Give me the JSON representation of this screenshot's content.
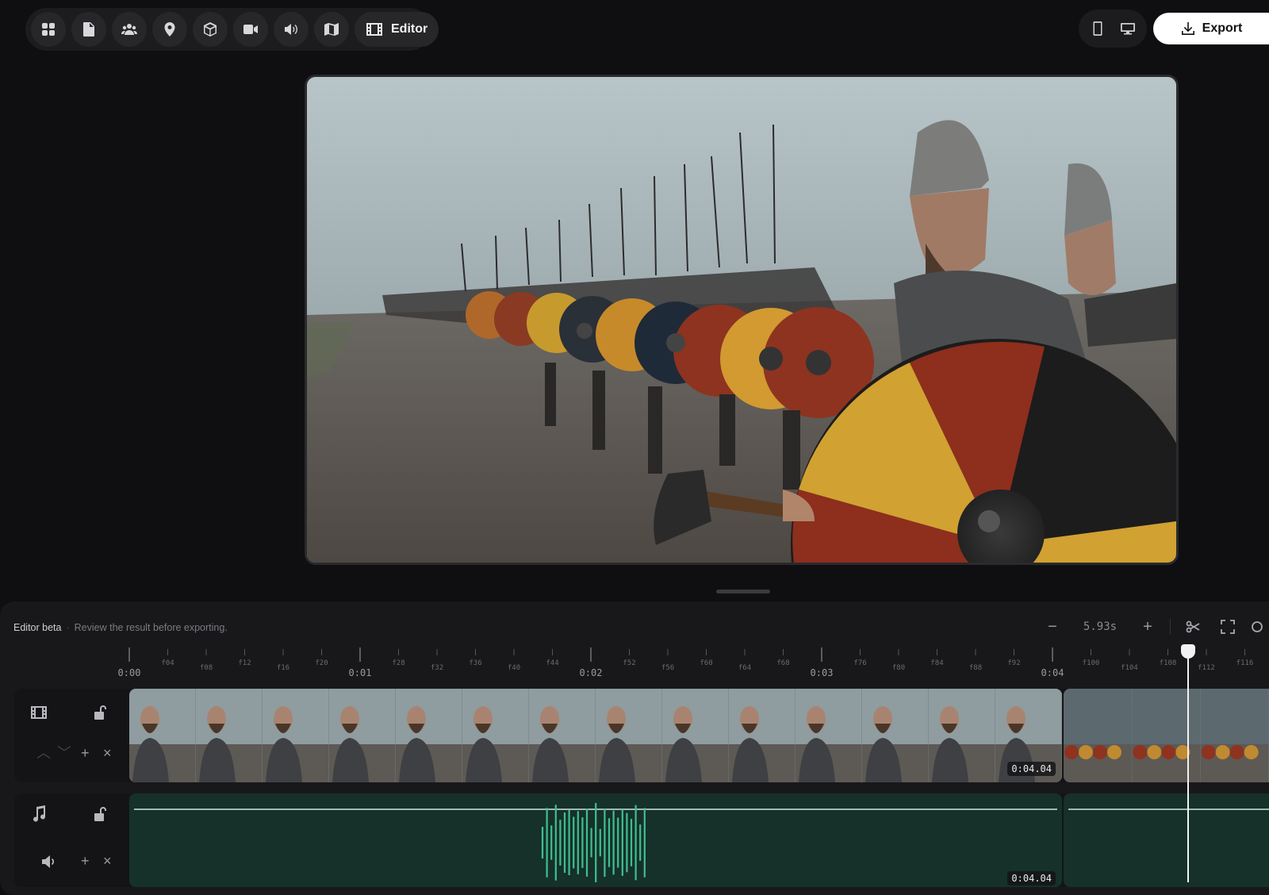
{
  "toolbar": {
    "icons": [
      "grid-icon",
      "document-icon",
      "people-icon",
      "location-icon",
      "cube-icon",
      "camera-icon",
      "speaker-icon",
      "map-icon"
    ],
    "editor_label": "Editor"
  },
  "header_right": {
    "devices": [
      "mobile-icon",
      "desktop-icon"
    ],
    "export_label": "Export"
  },
  "timeline": {
    "title": "Editor beta",
    "separator": "·",
    "subtitle": "Review the result before exporting.",
    "zoom_minus": "−",
    "zoom_value": "5.93s",
    "zoom_plus": "+",
    "ruler": {
      "seconds": [
        "0:00",
        "0:01",
        "0:02",
        "0:03",
        "0:04"
      ],
      "frames": [
        "f04",
        "f08",
        "f12",
        "f16",
        "f20",
        "f28",
        "f32",
        "f36",
        "f40",
        "f44",
        "f52",
        "f56",
        "f60",
        "f64",
        "f68",
        "f76",
        "f80",
        "f84",
        "f88",
        "f92",
        "f100",
        "f104",
        "f108",
        "f112",
        "f116"
      ]
    },
    "video_track": {
      "clip_duration": "0:04.04",
      "add": "+",
      "remove": "×",
      "up": "︿",
      "down": "﹀"
    },
    "audio_track": {
      "clip_duration": "0:04.04",
      "add": "+",
      "remove": "×"
    }
  },
  "colors": {
    "background": "#0f0f11",
    "panel": "#18181b",
    "audio_fill": "#16302a",
    "waveform": "#3fbf8f",
    "accent_white": "#ffffff"
  }
}
